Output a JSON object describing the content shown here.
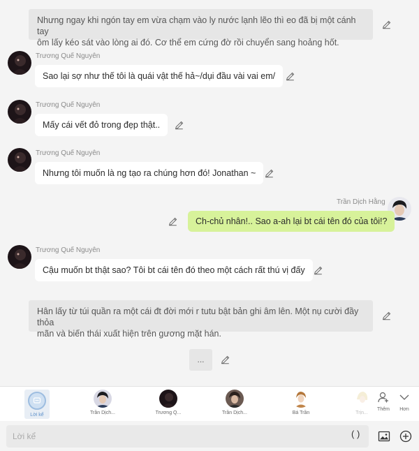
{
  "messages": [
    {
      "type": "narration",
      "text_lines": [
        "Nhưng ngay khi ngón tay em vừa chạm vào ly nước lạnh lẽo thì eo đã bị một cánh tay",
        "ôm lấy kéo  sát vào lòng ai đó. Cơ thể em cứng đờ rồi chuyển sang hoảng hốt."
      ]
    },
    {
      "type": "char",
      "name": "Trương Quế Nguyên",
      "text": "Sao lại sợ như thế tôi là quái vật thế hả~/dụi đầu vài vai em/"
    },
    {
      "type": "char",
      "name": "Trương Quế Nguyên",
      "text": "Mấy cái vết đỏ trong đẹp thật.."
    },
    {
      "type": "char",
      "name": "Trương Quế Nguyên",
      "text": "Nhưng tôi muốn là ng tạo ra chúng hơn đó! Jonathan ~"
    },
    {
      "type": "me",
      "name": "Trần Dịch Hằng",
      "text": "Ch-chủ nhân!.. Sao a-ah lại bt cái tên đó của tôi!?"
    },
    {
      "type": "char",
      "name": "Trương Quế Nguyên",
      "text": "Cậu muốn bt thật sao? Tôi bt cái tên đó theo một cách rất thú vị đấy"
    },
    {
      "type": "narration",
      "text_lines": [
        "Hân lấy từ túi quần ra một cái đt đời mới r tutu bật bản ghi âm lên. Một nụ cười đầy thỏa",
        "mãn và biến thái xuất hiện trên gương mặt hán."
      ]
    },
    {
      "type": "typing",
      "text": "..."
    }
  ],
  "characters": [
    {
      "label": "Lời kể",
      "active": true
    },
    {
      "label": "Trần Dịch..."
    },
    {
      "label": "Trương Q..."
    },
    {
      "label": "Trần Dịch..."
    },
    {
      "label": "Bá Trần"
    },
    {
      "label": "Trịn..."
    }
  ],
  "side_buttons": {
    "more_label": "Thêm",
    "collapse_label": "Hơn"
  },
  "input": {
    "placeholder": "Lời kể",
    "paren": "( )"
  },
  "colors": {
    "me_bubble": "#d7f29a",
    "narration_bg": "#e6e6e6",
    "accent": "#5b8fc9"
  },
  "icons": [
    "edit-icon",
    "avatar",
    "narration-icon",
    "add-person-icon",
    "chevron-down-icon",
    "image-icon",
    "plus-circle-icon"
  ]
}
